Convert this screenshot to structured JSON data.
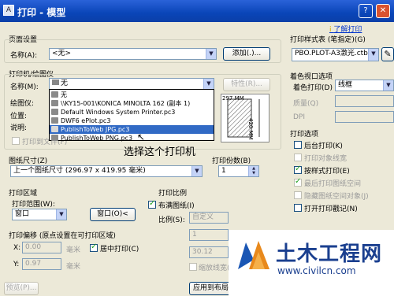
{
  "window": {
    "title": "打印 - 模型",
    "help_link": "了解打印"
  },
  "page_setup": {
    "group": "页面设置",
    "name_label": "名称(A):",
    "name_value": "<无>",
    "add_button": "添加(.)..."
  },
  "printer": {
    "group": "打印机/绘图仪",
    "name_label": "名称(M):",
    "name_value": "无",
    "properties_button": "特性(R)...",
    "plotter_label": "绘图仪:",
    "location_label": "位置:",
    "description_label": "说明:",
    "print_to_file": "打印到文件(F)",
    "dropdown_items": [
      "无",
      "\\\\KY15-001\\KONICA MINOLTA 162 (副本 1)",
      "Default Windows System Printer.pc3",
      "DWF6 ePlot.pc3",
      "PublishToWeb JPG.pc3",
      "PublishToWeb PNG.pc3"
    ],
    "selected_index": 4,
    "preview_width_label": "297 MM",
    "preview_height_label": "420 MM"
  },
  "annotation": "选择这个打印机",
  "paper_size": {
    "group": "图纸尺寸(Z)",
    "value": "上一个图纸尺寸 (296.97 x 419.95 毫米)"
  },
  "copies": {
    "group": "打印份数(B)",
    "value": "1"
  },
  "plot_area": {
    "group": "打印区域",
    "range_label": "打印范围(W):",
    "range_value": "窗口",
    "window_button": "窗口(O)<"
  },
  "plot_scale": {
    "group": "打印比例",
    "fit": "布满图纸(I)",
    "scale_label": "比例(S):",
    "scale_value": "自定义",
    "value1": "1",
    "value2": "30.12",
    "scale_lineweights": "缩放线宽(L)"
  },
  "plot_offset": {
    "group": "打印偏移 (原点设置在可打印区域)",
    "x_label": "X:",
    "x_value": "0.00",
    "y_label": "Y:",
    "y_value": "0.97",
    "unit": "毫米",
    "center": "居中打印(C)"
  },
  "bottom": {
    "preview_button": "预览(P)...",
    "apply_button": "应用到布局"
  },
  "style_table": {
    "group": "打印样式表 (笔指定)(G)",
    "value": "PBO.PLOT-A3激光.ctb"
  },
  "shaded": {
    "group": "着色视口选项",
    "shade_label": "着色打印(D)",
    "shade_value": "线框",
    "quality_label": "质量(Q)",
    "dpi_label": "DPI"
  },
  "options": {
    "group": "打印选项",
    "items": [
      {
        "label": "后台打印(K)",
        "checked": false,
        "enabled": true
      },
      {
        "label": "打印对象线宽",
        "checked": false,
        "enabled": false
      },
      {
        "label": "按样式打印(E)",
        "checked": true,
        "enabled": true
      },
      {
        "label": "最后打印图纸空间",
        "checked": true,
        "enabled": false
      },
      {
        "label": "隐藏图纸空间对象(J)",
        "checked": false,
        "enabled": false
      },
      {
        "label": "打开打印戳记(N)",
        "checked": false,
        "enabled": true
      }
    ]
  },
  "watermark": {
    "brand": "土木工程网",
    "url": "www.civilcn.com"
  },
  "colors": {
    "titlebar": "#0a45b8",
    "selection": "#316ac5",
    "dialog": "#ece9d8",
    "brand_orange": "#e8891c",
    "brand_blue": "#1a56b4"
  }
}
